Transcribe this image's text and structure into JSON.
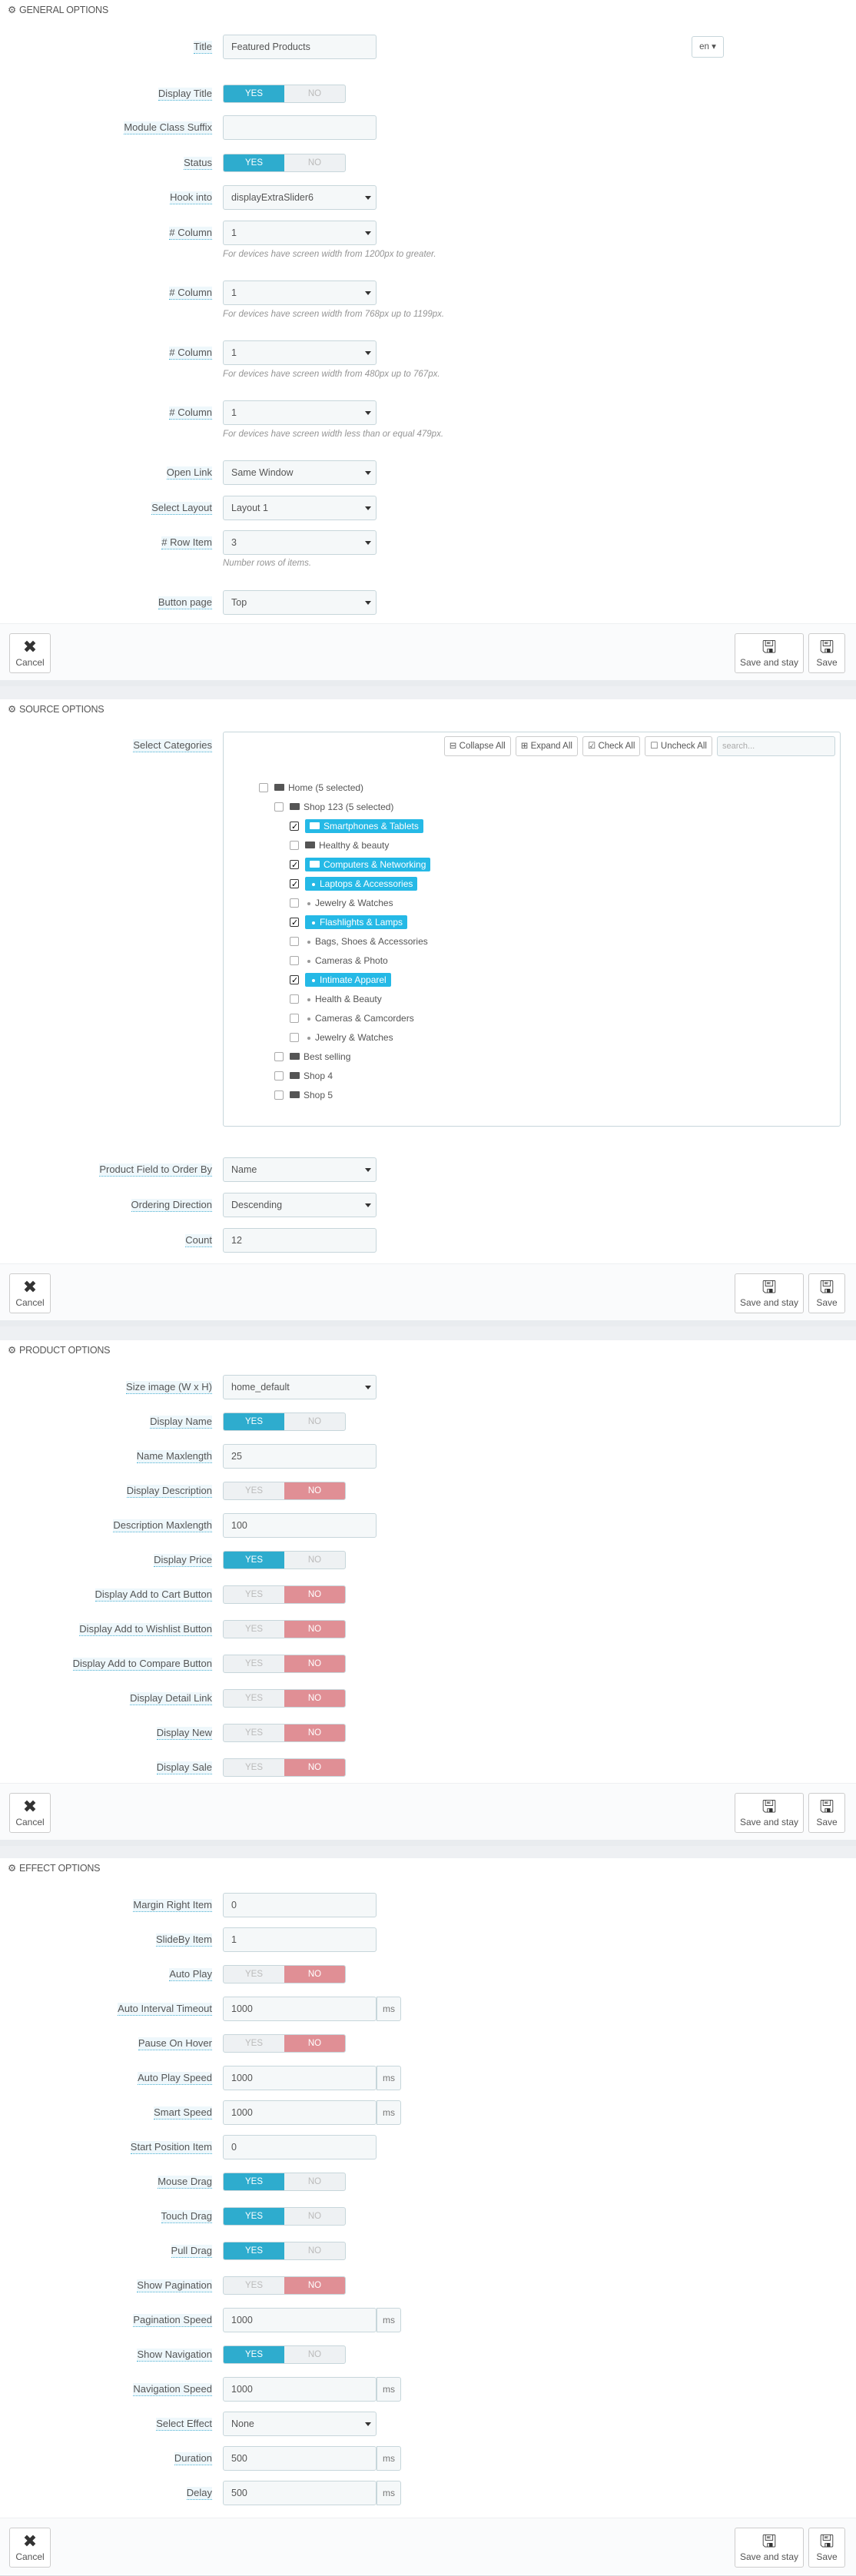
{
  "footer": {
    "cancel": "Cancel",
    "save_stay": "Save and stay",
    "save": "Save"
  },
  "general": {
    "heading": "GENERAL OPTIONS",
    "title_label": "Title",
    "title_value": "Featured Products",
    "lang": "en",
    "display_title_label": "Display Title",
    "suffix_label": "Module Class Suffix",
    "suffix_value": "",
    "status_label": "Status",
    "hook_label": "Hook into",
    "hook_value": "displayExtraSlider6",
    "col_label": "# Column",
    "col1": "1",
    "col1_help": "For devices have screen width from 1200px to greater.",
    "col2": "1",
    "col2_help": "For devices have screen width from 768px up to 1199px.",
    "col3": "1",
    "col3_help": "For devices have screen width from 480px up to 767px.",
    "col4": "1",
    "col4_help": "For devices have screen width less than or equal 479px.",
    "open_link_label": "Open Link",
    "open_link_value": "Same Window",
    "layout_label": "Select Layout",
    "layout_value": "Layout 1",
    "row_label": "# Row Item",
    "row_value": "3",
    "row_help": "Number rows of items.",
    "btnpage_label": "Button page",
    "btnpage_value": "Top"
  },
  "yes": "YES",
  "no": "NO",
  "ms": "ms",
  "source": {
    "heading": "SOURCE OPTIONS",
    "cat_label": "Select Categories",
    "collapse": "Collapse All",
    "expand": "Expand All",
    "check": "Check All",
    "uncheck": "Uncheck All",
    "search_ph": "search...",
    "tree": [
      "Home (5 selected)",
      "Shop 123 (5 selected)",
      "Smartphones & Tablets",
      "Healthy & beauty",
      "Computers & Networking",
      "Laptops & Accessories",
      "Jewelry & Watches",
      "Flashlights & Lamps",
      "Bags, Shoes & Accessories",
      "Cameras & Photo",
      "Intimate Apparel",
      "Health & Beauty",
      "Cameras & Camcorders",
      "Jewelry & Watches",
      "Best selling",
      "Shop 4",
      "Shop 5"
    ],
    "order_label": "Product Field to Order By",
    "order_value": "Name",
    "dir_label": "Ordering Direction",
    "dir_value": "Descending",
    "count_label": "Count",
    "count_value": "12"
  },
  "product": {
    "heading": "PRODUCT OPTIONS",
    "size_label": "Size image (W x H)",
    "size_value": "home_default",
    "dname_label": "Display Name",
    "nmax_label": "Name Maxlength",
    "nmax_value": "25",
    "ddesc_label": "Display Description",
    "dmax_label": "Description Maxlength",
    "dmax_value": "100",
    "dprice_label": "Display Price",
    "dcart_label": "Display Add to Cart Button",
    "dwish_label": "Display Add to Wishlist Button",
    "dcomp_label": "Display Add to Compare Button",
    "ddetail_label": "Display Detail Link",
    "dnew_label": "Display New",
    "dsale_label": "Display Sale"
  },
  "effect": {
    "heading": "EFFECT OPTIONS",
    "margin_label": "Margin Right Item",
    "margin_value": "0",
    "slideby_label": "SlideBy Item",
    "slideby_value": "1",
    "autoplay_label": "Auto Play",
    "interval_label": "Auto Interval Timeout",
    "interval_value": "1000",
    "pause_label": "Pause On Hover",
    "apspeed_label": "Auto Play Speed",
    "apspeed_value": "1000",
    "smart_label": "Smart Speed",
    "smart_value": "1000",
    "startpos_label": "Start Position Item",
    "startpos_value": "0",
    "mouse_label": "Mouse Drag",
    "touch_label": "Touch Drag",
    "pull_label": "Pull Drag",
    "showpag_label": "Show Pagination",
    "pagspeed_label": "Pagination Speed",
    "pagspeed_value": "1000",
    "shownav_label": "Show Navigation",
    "navspeed_label": "Navigation Speed",
    "navspeed_value": "1000",
    "effect_label": "Select Effect",
    "effect_value": "None",
    "duration_label": "Duration",
    "duration_value": "500",
    "delay_label": "Delay",
    "delay_value": "500"
  }
}
